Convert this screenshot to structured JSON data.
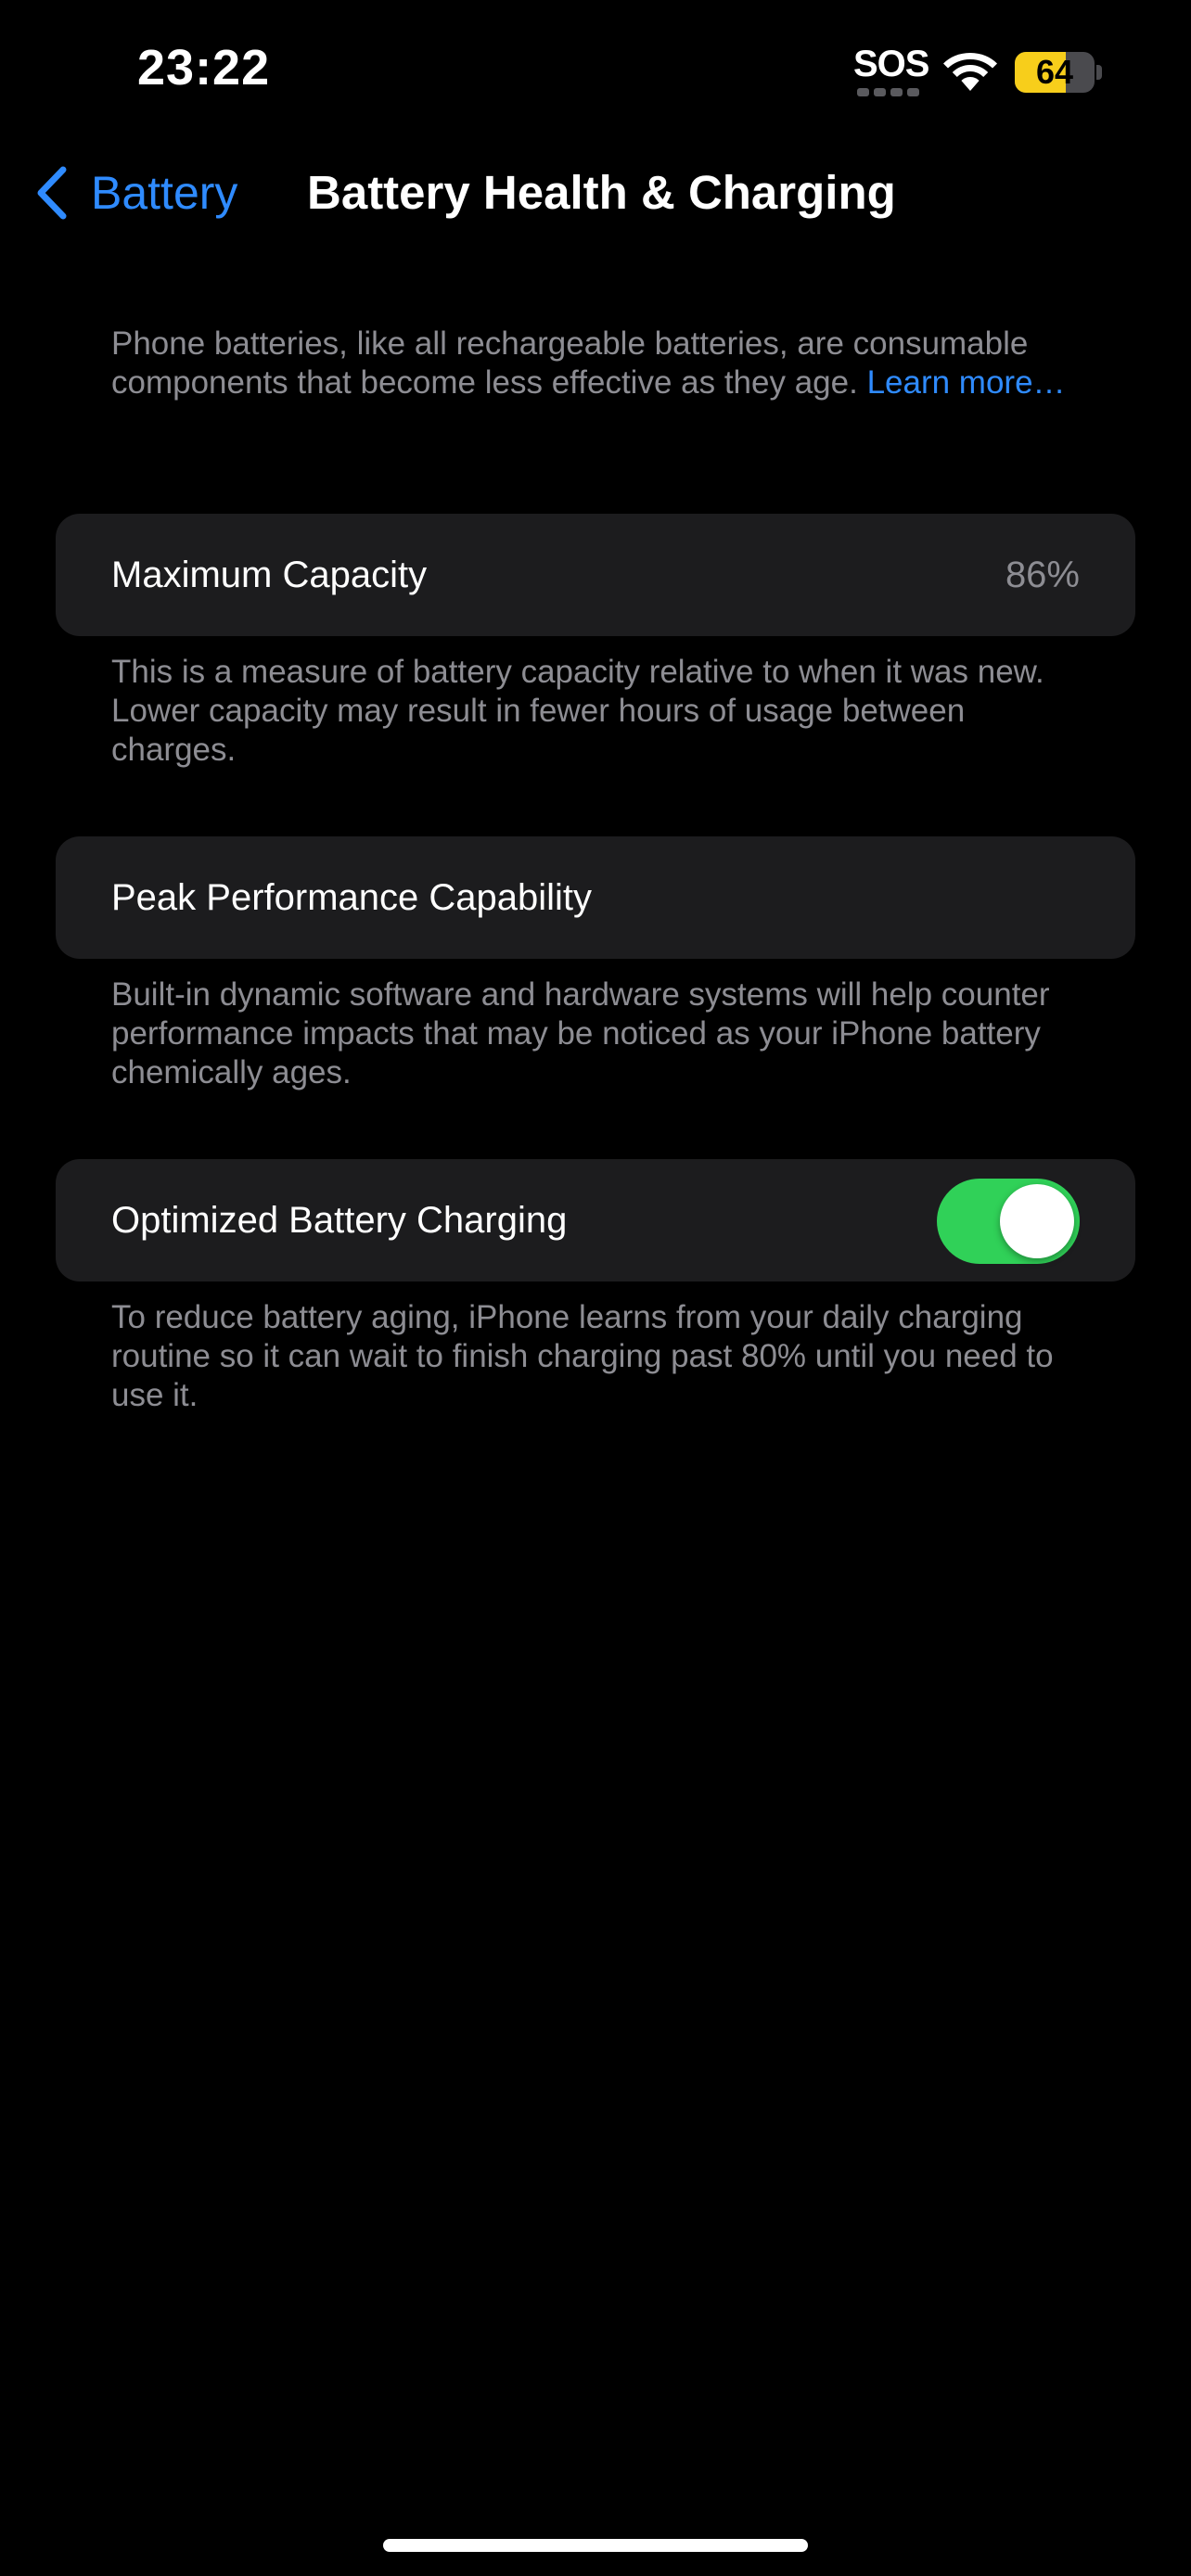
{
  "status_bar": {
    "time": "23:22",
    "sos": "SOS",
    "battery_level": "64",
    "battery_fraction": 0.64,
    "battery_color": "#f7ce1b",
    "icons": [
      "wifi-icon",
      "battery-icon"
    ]
  },
  "nav": {
    "back_label": "Battery",
    "title": "Battery Health & Charging",
    "accent_color": "#2f8bff"
  },
  "intro": {
    "text": "Phone batteries, like all rechargeable batteries, are consumable components that become less effective as they age. ",
    "link": "Learn more…"
  },
  "maximum_capacity": {
    "label": "Maximum Capacity",
    "value": "86%",
    "footnote": "This is a measure of battery capacity relative to when it was new. Lower capacity may result in fewer hours of usage between charges."
  },
  "peak_performance": {
    "label": "Peak Performance Capability",
    "footnote": "Built-in dynamic software and hardware systems will help counter performance impacts that may be noticed as your iPhone battery chemically ages."
  },
  "optimized_charging": {
    "label": "Optimized Battery Charging",
    "enabled": true,
    "toggle_color": "#30d158",
    "footnote": "To reduce battery aging, iPhone learns from your daily charging routine so it can wait to finish charging past 80% until you need to use it."
  }
}
